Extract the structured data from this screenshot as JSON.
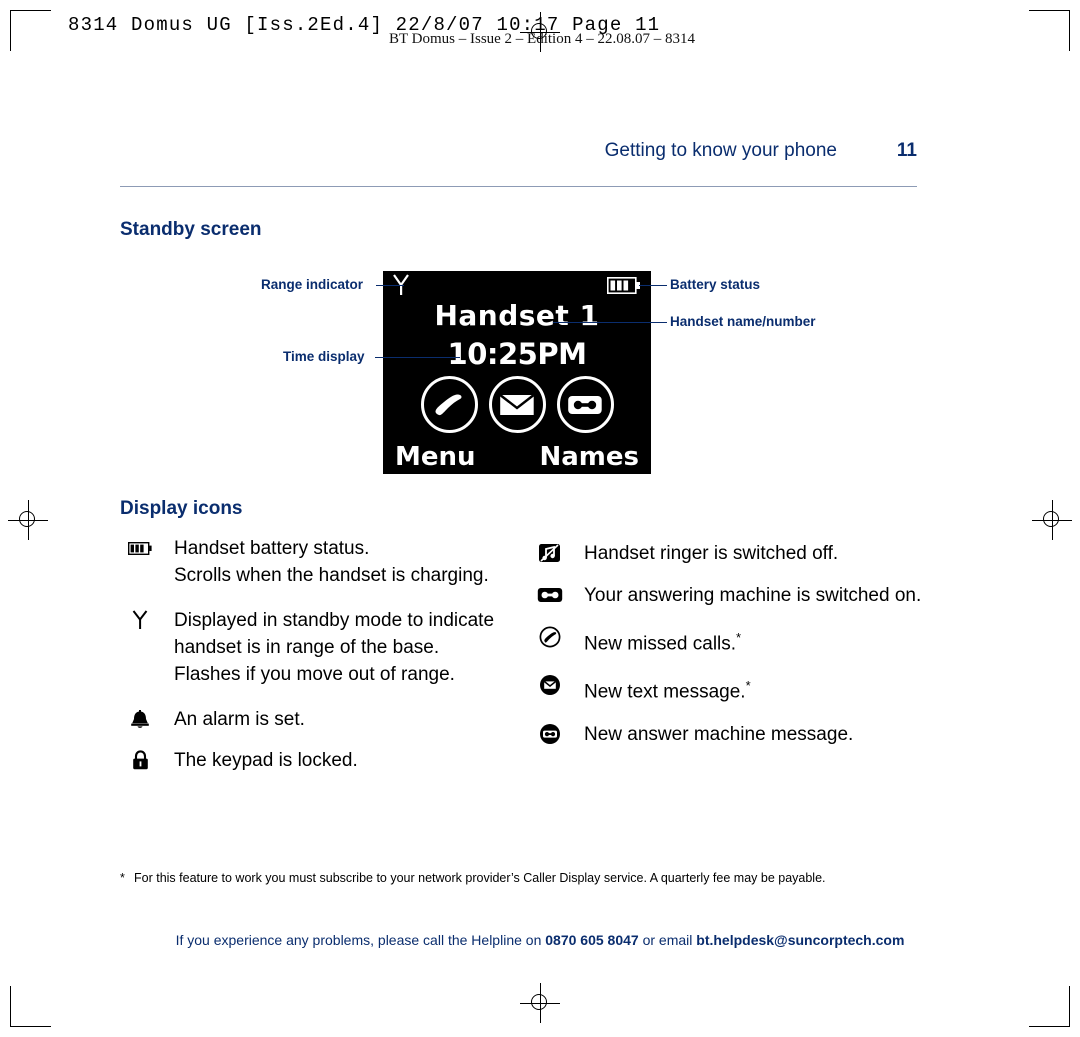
{
  "printer": {
    "slug": "8314 Domus UG [Iss.2Ed.4]  22/8/07  10:17  Page 11",
    "subslug": "BT Domus – Issue 2 – Edition 4 – 22.08.07 – 8314"
  },
  "header": {
    "title": "Getting to know your phone",
    "page_number": "11"
  },
  "sections": {
    "standby": "Standby screen",
    "display_icons": "Display icons"
  },
  "screen": {
    "handset_name": "Handset 1",
    "time": "10:25PM",
    "softkey_left": "Menu",
    "softkey_right": "Names",
    "icons": [
      "phone-handset-icon",
      "envelope-icon",
      "answer-machine-icon"
    ],
    "status_icons": [
      "antenna-icon",
      "battery-icon"
    ]
  },
  "callouts": {
    "range": "Range indicator",
    "time": "Time display",
    "battery": "Battery status",
    "handset_name": "Handset name/number"
  },
  "icon_list_left": [
    {
      "icon": "battery-icon",
      "lines": [
        "Handset battery status.",
        "Scrolls when the handset is charging."
      ]
    },
    {
      "icon": "antenna-icon",
      "lines": [
        "Displayed in standby mode to indicate",
        "handset is in range of the base.",
        "Flashes if you move out of range."
      ]
    },
    {
      "icon": "alarm-bell-icon",
      "lines": [
        "An alarm is set."
      ]
    },
    {
      "icon": "padlock-icon",
      "lines": [
        "The keypad is locked."
      ]
    }
  ],
  "icon_list_right": [
    {
      "icon": "ringer-off-icon",
      "lines": [
        "Handset ringer is switched off."
      ]
    },
    {
      "icon": "answer-machine-icon",
      "lines": [
        "Your answering machine is switched on."
      ]
    },
    {
      "icon": "missed-call-icon",
      "lines": [
        "New missed calls."
      ],
      "footnote_mark": "*"
    },
    {
      "icon": "new-text-message-icon",
      "lines": [
        "New text message."
      ],
      "footnote_mark": "*"
    },
    {
      "icon": "new-answer-message-icon",
      "lines": [
        "New answer machine message."
      ]
    }
  ],
  "footnote": {
    "mark": "*",
    "text": "For this feature to work you must subscribe to your network provider’s Caller Display service. A quarterly fee may be payable."
  },
  "helpline": {
    "prefix": "If you experience any problems, please call the Helpline on ",
    "number": "0870 605 8047",
    "middle": " or email ",
    "email": "bt.helpdesk@suncorptech.com"
  },
  "colors": {
    "brand_blue": "#0a2d6e",
    "rule": "#8d9bb5",
    "screen_bg": "#000000"
  }
}
